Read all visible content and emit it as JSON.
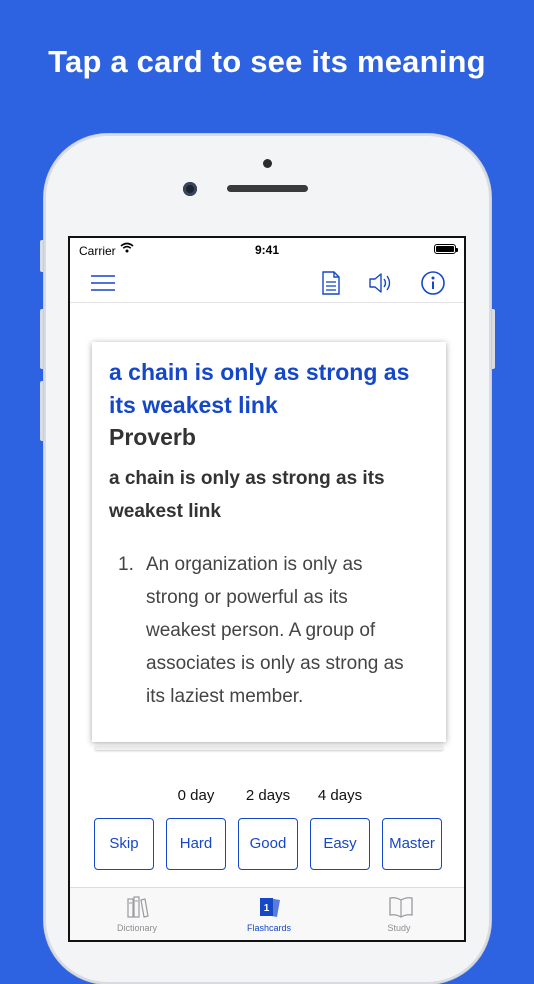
{
  "headline": "Tap a card to see its meaning",
  "status_bar": {
    "carrier": "Carrier",
    "time": "9:41"
  },
  "navbar": {
    "menu_icon": "hamburger-menu-icon",
    "document_icon": "document-icon",
    "sound_icon": "speaker-icon",
    "info_icon": "info-icon"
  },
  "card": {
    "term": "a chain is only as strong as its weakest link",
    "part_of_speech": "Proverb",
    "headword": "a chain is only as strong as its weakest link",
    "definitions": [
      {
        "number": "1.",
        "text": "An organization is only as strong or powerful as its weakest person. A group of associates is only as strong as its laziest member."
      }
    ]
  },
  "intervals": {
    "hard": "0 day",
    "good": "2 days",
    "easy": "4 days"
  },
  "buttons": {
    "skip": "Skip",
    "hard": "Hard",
    "good": "Good",
    "easy": "Easy",
    "master": "Master"
  },
  "tabs": [
    {
      "label": "Dictionary",
      "icon": "books-icon",
      "active": false
    },
    {
      "label": "Flashcards",
      "icon": "flashcards-icon",
      "active": true
    },
    {
      "label": "Study",
      "icon": "open-book-icon",
      "active": false
    }
  ],
  "colors": {
    "background": "#2d63e0",
    "accent": "#1547c9",
    "inactive_tab": "#8e8e93"
  }
}
